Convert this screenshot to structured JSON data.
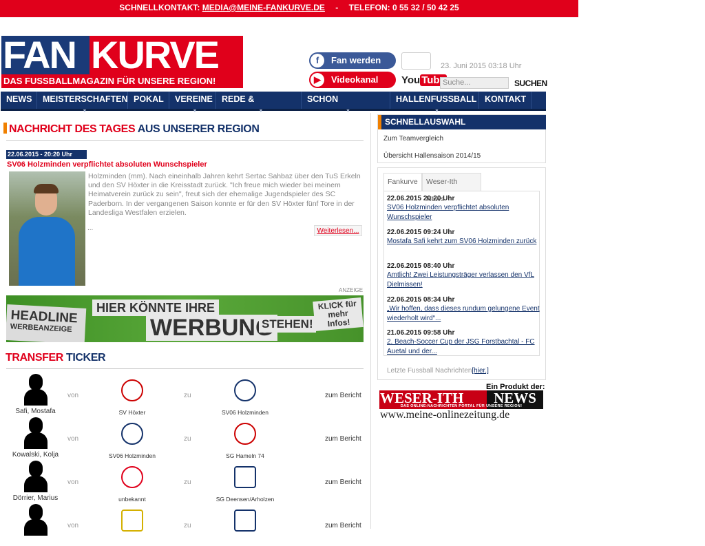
{
  "topbar": {
    "label": "SCHNELLKONTAKT:",
    "email": "MEDIA@MEINE-FANKURVE.DE",
    "sep": "-",
    "phone": "TELEFON: 0 55 32 / 50 42 25"
  },
  "logo": {
    "fan": "FAN",
    "kurve": "KURVE",
    "tagline": "DAS FUSSBALLMAGAZIN FÜR UNSERE REGION!"
  },
  "social": {
    "fb_label": "Fan werden",
    "video_label": "Videokanal",
    "youtube": "You",
    "youtube2": "Tube"
  },
  "header": {
    "date": "23. Juni 2015 03:18 Uhr",
    "search_placeholder": "Suche...",
    "search_button": "SUCHEN"
  },
  "nav": [
    "NEWS",
    "MEISTERSCHAFTEN",
    "POKAL",
    "VEREINE",
    "REDE & ANTWORT",
    "SCHON GEWUSST?",
    "HALLENFUSSBALL",
    "KONTAKT"
  ],
  "news_of_day": {
    "h1": "NACHRICHT DES TAGES",
    "h2": "AUS UNSERER REGION",
    "date": "22.06.2015 - 20:20 Uhr",
    "title": "SV06 Holzminden verpflichtet absoluten Wunschspieler",
    "text": "Holzminden (mm). Nach eineinhalb Jahren kehrt Sertac Sahbaz über den TuS Erkeln und den SV Höxter in die Kreisstadt zurück. \"Ich freue mich wieder bei meinem Heimatverein zurück zu sein\", freut sich der ehemalige Jugendspieler des SC Paderborn. In der vergangenen Saison konnte er für den SV Höxter fünf Tore in der Landesliga Westfalen erzielen.",
    "dots": "...",
    "more": "Weiterlesen..."
  },
  "ad": {
    "label": "ANZEIGE",
    "headline": "HEADLINE",
    "headline2": "WERBEANZEIGE",
    "w1": "HIER KÖNNTE IHRE",
    "w2": "WERBUNG",
    "w3": "STEHEN!",
    "w4": "KLICK für mehr Infos!"
  },
  "transfer": {
    "h1": "TRANSFER",
    "h2": "TICKER",
    "von": "von",
    "zu": "zu",
    "report": "zum Bericht",
    "rows": [
      {
        "name": "Safi, Mostafa",
        "from": "SV Höxter",
        "to": "SV06 Holzminden"
      },
      {
        "name": "Kowalski, Kolja",
        "from": "SV06 Holzminden",
        "to": "SG Hameln 74"
      },
      {
        "name": "Dörrier, Marius",
        "from": "unbekannt",
        "to": "SG Deensen/Arholzen"
      },
      {
        "name": "",
        "from": "",
        "to": ""
      }
    ]
  },
  "quick": {
    "title": "SCHNELLAUSWAHL",
    "links": [
      "Zum Teamvergleich",
      "Übersicht Hallensaison 2014/15"
    ]
  },
  "newsbox": {
    "tabs": [
      "Fankurve",
      "Weser-Ith News"
    ],
    "items": [
      {
        "date": "22.06.2015 20:20 Uhr",
        "title": "SV06 Holzminden verpflichtet absoluten Wunschspieler"
      },
      {
        "date": "22.06.2015 09:24 Uhr",
        "title": "Mostafa Safi kehrt zum SV06 Holzminden zurück"
      },
      {
        "date": "22.06.2015 08:40 Uhr",
        "title": "Amtlich! Zwei Leistungsträger verlassen den VfL Dielmissen!"
      },
      {
        "date": "22.06.2015 08:34 Uhr",
        "title": "„Wir hoffen, dass dieses rundum gelungene Event wiederholt wird“..."
      },
      {
        "date": "21.06.2015 09:58 Uhr",
        "title": "2. Beach-Soccer Cup der JSG Forstbachtal - FC Auetal und der..."
      }
    ],
    "latest": "Letzte Fussball Nachrichten",
    "latest_link": "[hier.]"
  },
  "product": {
    "label": "Ein Produkt der:",
    "brand1": "WESER-ITH",
    "brand2": "NEWS",
    "sub": "DAS ONLINE-NACHRICHTEN PORTAL FÜR UNSERE REGION!",
    "url": "www.meine-onlinezeitung.de"
  },
  "colors": {
    "brand_red": "#e0001b",
    "brand_blue": "#14326a",
    "accent_orange": "#f08000"
  }
}
